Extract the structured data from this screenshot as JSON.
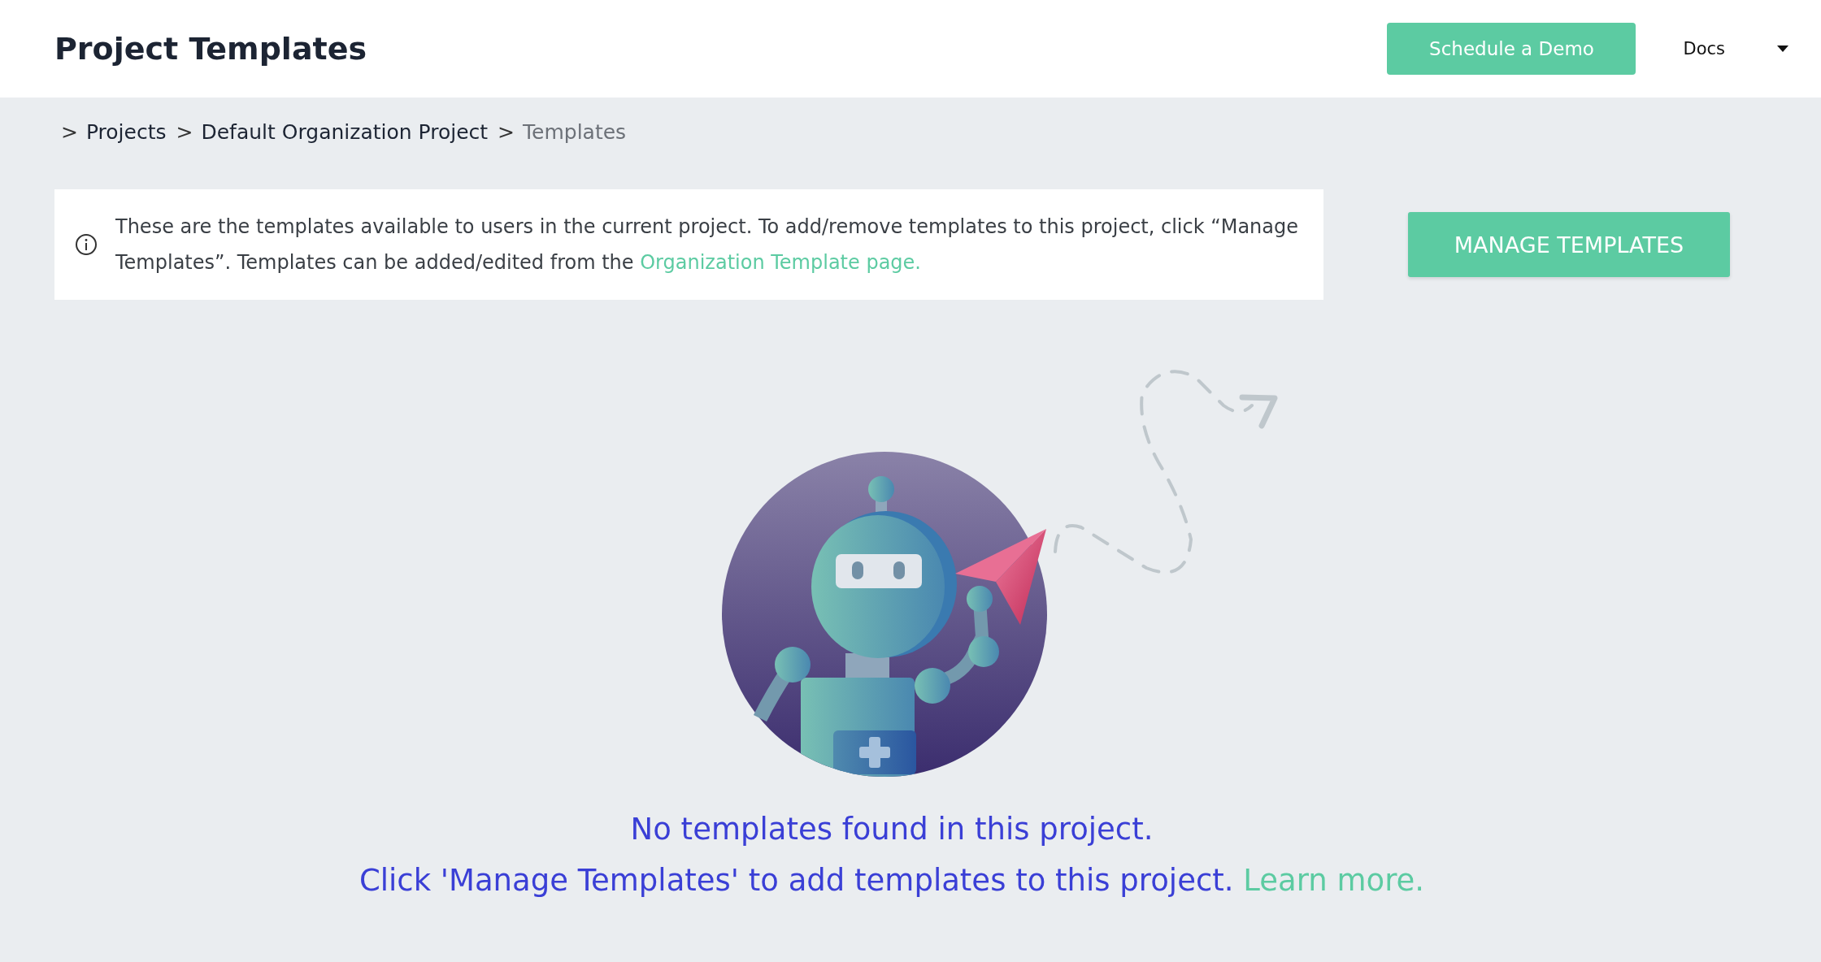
{
  "header": {
    "title": "Project Templates",
    "demo_button": "Schedule a Demo",
    "docs_link": "Docs"
  },
  "breadcrumb": [
    {
      "separator": ">",
      "label": "Projects",
      "current": false
    },
    {
      "separator": ">",
      "label": "Default Organization Project",
      "current": false
    },
    {
      "separator": ">",
      "label": "Templates",
      "current": true
    }
  ],
  "info_box": {
    "text": "These are the templates available to users in the current project. To add/remove templates to this project, click “Manage Templates”. Templates can be added/edited from the ",
    "link": "Organization Template page."
  },
  "manage_button": "MANAGE TEMPLATES",
  "empty_state": {
    "title": "No templates found in this project.",
    "message": "Click 'Manage Templates' to add templates to this project. ",
    "link": "Learn more."
  }
}
